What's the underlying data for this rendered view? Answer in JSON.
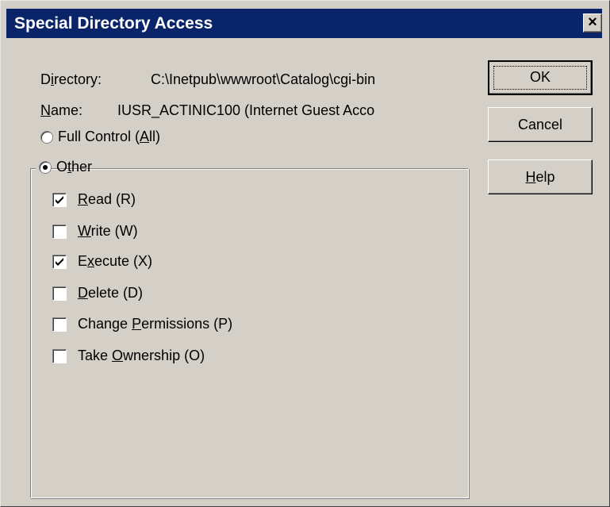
{
  "window": {
    "title": "Special Directory Access",
    "close_glyph": "×"
  },
  "info": {
    "directory_label": "Directory:",
    "directory_value": "C:\\Inetpub\\wwwroot\\Catalog\\cgi-bin",
    "name_label": "Name:",
    "name_value": "IUSR_ACTINIC100 (Internet Guest Acco"
  },
  "access": {
    "full_control": {
      "label": "Full Control (All)",
      "selected": false
    },
    "other": {
      "label": "Other",
      "selected": true
    }
  },
  "permissions": [
    {
      "label": "Read (R)",
      "checked": true
    },
    {
      "label": "Write (W)",
      "checked": false
    },
    {
      "label": "Execute (X)",
      "checked": true
    },
    {
      "label": "Delete (D)",
      "checked": false
    },
    {
      "label": "Change Permissions (P)",
      "checked": false
    },
    {
      "label": "Take Ownership (O)",
      "checked": false
    }
  ],
  "buttons": {
    "ok": "OK",
    "cancel": "Cancel",
    "help": "Help"
  },
  "colors": {
    "titlebar": "#0a246a",
    "face": "#d4d0c8"
  }
}
